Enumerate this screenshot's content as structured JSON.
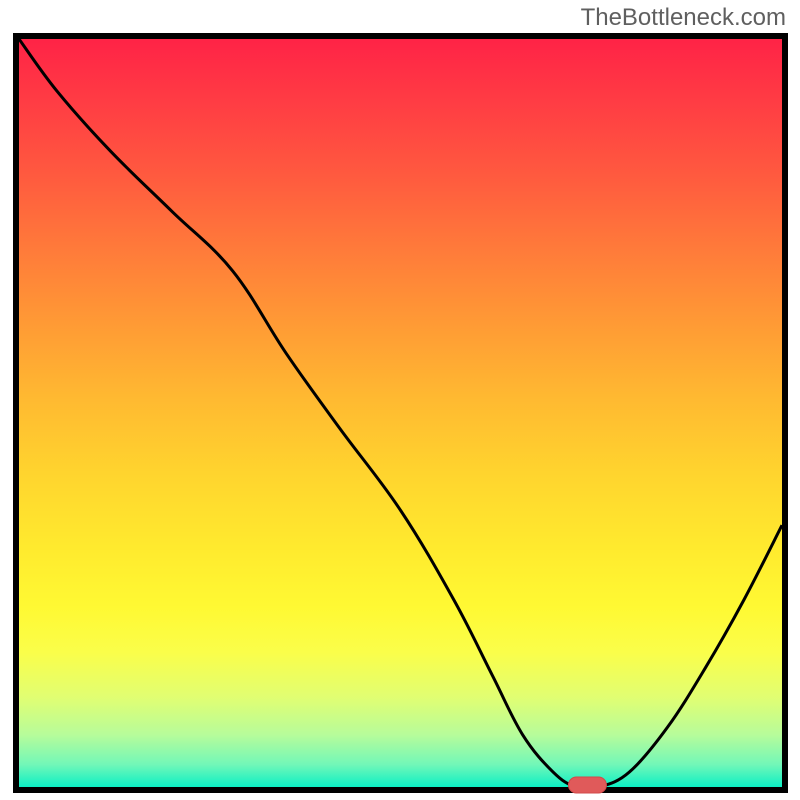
{
  "watermark": "TheBottleneck.com",
  "chart_data": {
    "type": "line",
    "title": "",
    "xlabel": "",
    "ylabel": "",
    "xlim": [
      0,
      100
    ],
    "ylim": [
      0,
      100
    ],
    "grid": false,
    "legend": false,
    "background": "gradient-red-yellow-green",
    "series": [
      {
        "name": "bottleneck-curve",
        "x": [
          0,
          5,
          12,
          20,
          28,
          35,
          42,
          50,
          57,
          62,
          66,
          70,
          73,
          76,
          80,
          85,
          90,
          95,
          100
        ],
        "values": [
          100,
          93,
          85,
          77,
          69,
          58,
          48,
          37,
          25,
          15,
          7,
          2,
          0,
          0,
          2,
          8,
          16,
          25,
          35
        ]
      }
    ],
    "marker": {
      "x": 74.5,
      "y": 0,
      "shape": "pill",
      "color": "#e05a5a"
    }
  }
}
